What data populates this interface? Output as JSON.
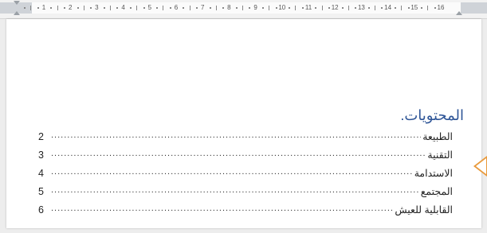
{
  "ruler": {
    "numbers": [
      "1",
      "2",
      "3",
      "4",
      "5",
      "6",
      "7",
      "8",
      "9",
      "10",
      "11",
      "12",
      "13",
      "14",
      "15",
      "16"
    ]
  },
  "document": {
    "toc_title": "المحتويات.",
    "entries": [
      {
        "text": "الطبيعة",
        "page": "2"
      },
      {
        "text": "التقنية",
        "page": "3"
      },
      {
        "text": "الاستدامة",
        "page": "4"
      },
      {
        "text": "المجتمع",
        "page": "5"
      },
      {
        "text": "القابلية للعيش",
        "page": "6"
      }
    ],
    "leader": "......................................................................................................................................................"
  },
  "colors": {
    "title": "#2e5597",
    "arrow": "#e99a3c"
  }
}
